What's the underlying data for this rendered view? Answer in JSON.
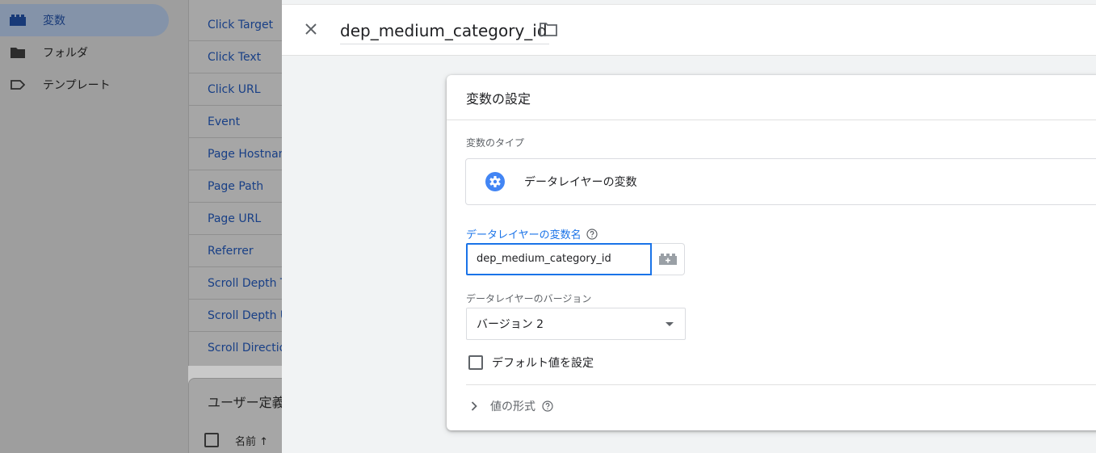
{
  "leftnav": {
    "items": [
      {
        "label": "変数",
        "icon": "bricks-icon",
        "active": true
      },
      {
        "label": "フォルダ",
        "icon": "folder-icon",
        "active": false
      },
      {
        "label": "テンプレート",
        "icon": "label-outline-icon",
        "active": false
      }
    ]
  },
  "builtin_variables": {
    "items": [
      "Click Target",
      "Click Text",
      "Click URL",
      "Event",
      "Page Hostname",
      "Page Path",
      "Page URL",
      "Referrer",
      "Scroll Depth Threshold",
      "Scroll Depth Units",
      "Scroll Direction"
    ]
  },
  "user_defined": {
    "title": "ユーザー定義",
    "column_name": "名前 ↑"
  },
  "editor": {
    "title": "dep_medium_category_id",
    "card_title": "変数の設定",
    "type_label": "変数のタイプ",
    "type_name": "データレイヤーの変数",
    "name_label": "データレイヤーの変数名",
    "name_value": "dep_medium_category_id",
    "version_label": "データレイヤーのバージョン",
    "version_value": "バージョン 2",
    "default_label": "デフォルト値を設定",
    "format_label": "値の形式"
  },
  "colors": {
    "accent": "#1a73e8",
    "gear_blue": "#4285f4"
  }
}
